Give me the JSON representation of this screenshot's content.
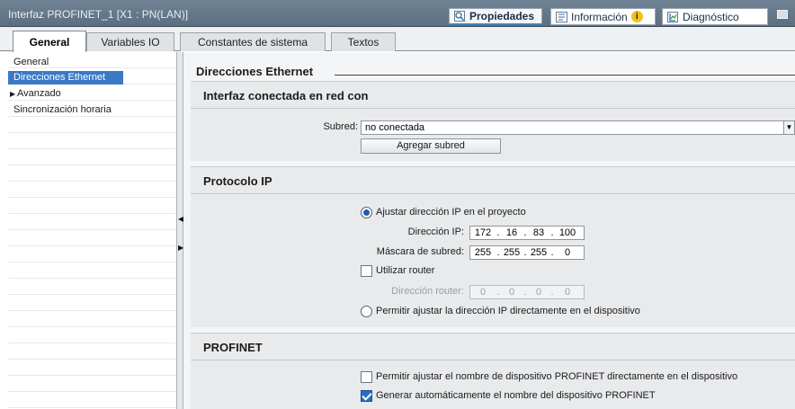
{
  "window": {
    "title": "Interfaz PROFINET_1 [X1 : PN(LAN)]",
    "tabs": [
      {
        "label": "Propiedades",
        "icon": "properties-icon"
      },
      {
        "label": "Información",
        "icon": "info-icon"
      },
      {
        "label": "Diagnóstico",
        "icon": "diagnostics-icon"
      }
    ]
  },
  "tabs": [
    "General",
    "Variables IO",
    "Constantes de sistema",
    "Textos"
  ],
  "nav": {
    "items": [
      "General",
      "Direcciones Ethernet",
      "Avanzado",
      "Sincronización horaria"
    ],
    "selected": "Direcciones Ethernet"
  },
  "content": {
    "section_title": "Direcciones Ethernet",
    "network": {
      "title": "Interfaz conectada en red con",
      "subnet_label": "Subred:",
      "subnet_value": "no conectada",
      "add_subnet_button": "Agregar subred"
    },
    "ip": {
      "title": "Protocolo IP",
      "radio_set_ip": "Ajustar dirección IP en el proyecto",
      "ip_label": "Dirección IP:",
      "ip": [
        "172",
        "16",
        "83",
        "100"
      ],
      "mask_label": "Máscara de subred:",
      "mask": [
        "255",
        "255",
        "255",
        "0"
      ],
      "use_router_label": "Utilizar router",
      "router_label": "Dirección router:",
      "router": [
        "0",
        "0",
        "0",
        "0"
      ],
      "radio_device_ip": "Permitir ajustar la dirección IP directamente en el dispositivo"
    },
    "profinet": {
      "title": "PROFINET",
      "allow_name_label": "Permitir ajustar el nombre de dispositivo PROFINET directamente en el dispositivo",
      "auto_name_label": "Generar automáticamente el nombre del dispositivo PROFINET"
    }
  }
}
